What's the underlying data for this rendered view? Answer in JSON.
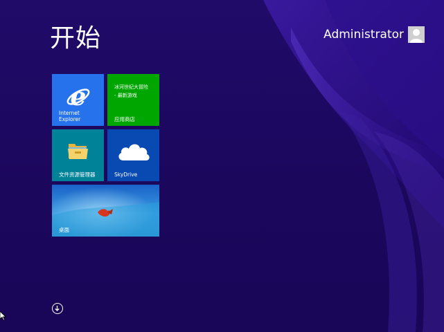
{
  "start_screen": {
    "title": "开始",
    "user": {
      "name": "Administrator",
      "avatar_icon": "user-avatar-icon"
    },
    "tiles": [
      {
        "id": "ie",
        "label": "Internet\nExplorer",
        "icon": "internet-explorer-icon",
        "color": "#2672ec"
      },
      {
        "id": "store",
        "subtitle": "冰河世纪大冒险\n- 最新游戏",
        "label": "应用商店",
        "color": "#00a600"
      },
      {
        "id": "explorer",
        "label": "文件资源管理器",
        "icon": "folder-icon",
        "color": "#008299"
      },
      {
        "id": "skydrive",
        "label": "SkyDrive",
        "icon": "cloud-icon",
        "color": "#094ab2"
      },
      {
        "id": "desktop",
        "label": "桌面",
        "icon": "desktop-wallpaper",
        "color": "#1e6fd0"
      }
    ],
    "scroll_icon": "arrow-down-circle-icon",
    "colors": {
      "background": "#1c0a5e",
      "accent_swoosh": "#3a1a9a"
    }
  }
}
